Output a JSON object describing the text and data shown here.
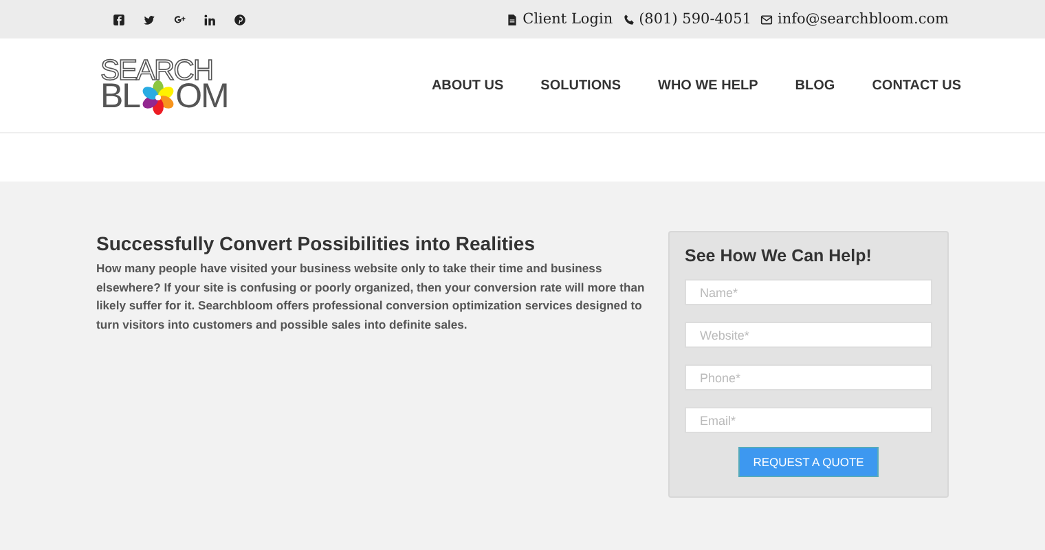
{
  "top_bar": {
    "social": [
      {
        "kind": "facebook"
      },
      {
        "kind": "twitter"
      },
      {
        "kind": "googleplus"
      },
      {
        "kind": "linkedin"
      },
      {
        "kind": "pinterest"
      }
    ],
    "contacts": [
      {
        "kind": "document",
        "label": "Client Login"
      },
      {
        "kind": "phone",
        "label": "(801) 590-4051"
      },
      {
        "kind": "mail",
        "label": "info@searchbloom.com"
      }
    ]
  },
  "logo": {
    "line_1": "SEARCH",
    "line_2_start": "BL",
    "line_2_end": "OM"
  },
  "nav": [
    "ABOUT US",
    "SOLUTIONS",
    "WHO WE HELP",
    "BLOG",
    "CONTACT US"
  ],
  "article": {
    "heading": "Successfully Convert Possibilities into Realities",
    "body": "How many people have visited your business website only to take their time and business elsewhere? If your site is confusing or poorly organized, then your conversion rate will more than likely suffer for it. Searchbloom offers professional conversion optimization services designed to turn visitors into customers and possible sales into definite sales."
  },
  "form": {
    "title": "See How We Can Help!",
    "fields": [
      {
        "placeholder": "Name*"
      },
      {
        "placeholder": "Website*"
      },
      {
        "placeholder": "Phone*"
      },
      {
        "placeholder": "Email*"
      }
    ],
    "button": "REQUEST A QUOTE"
  }
}
